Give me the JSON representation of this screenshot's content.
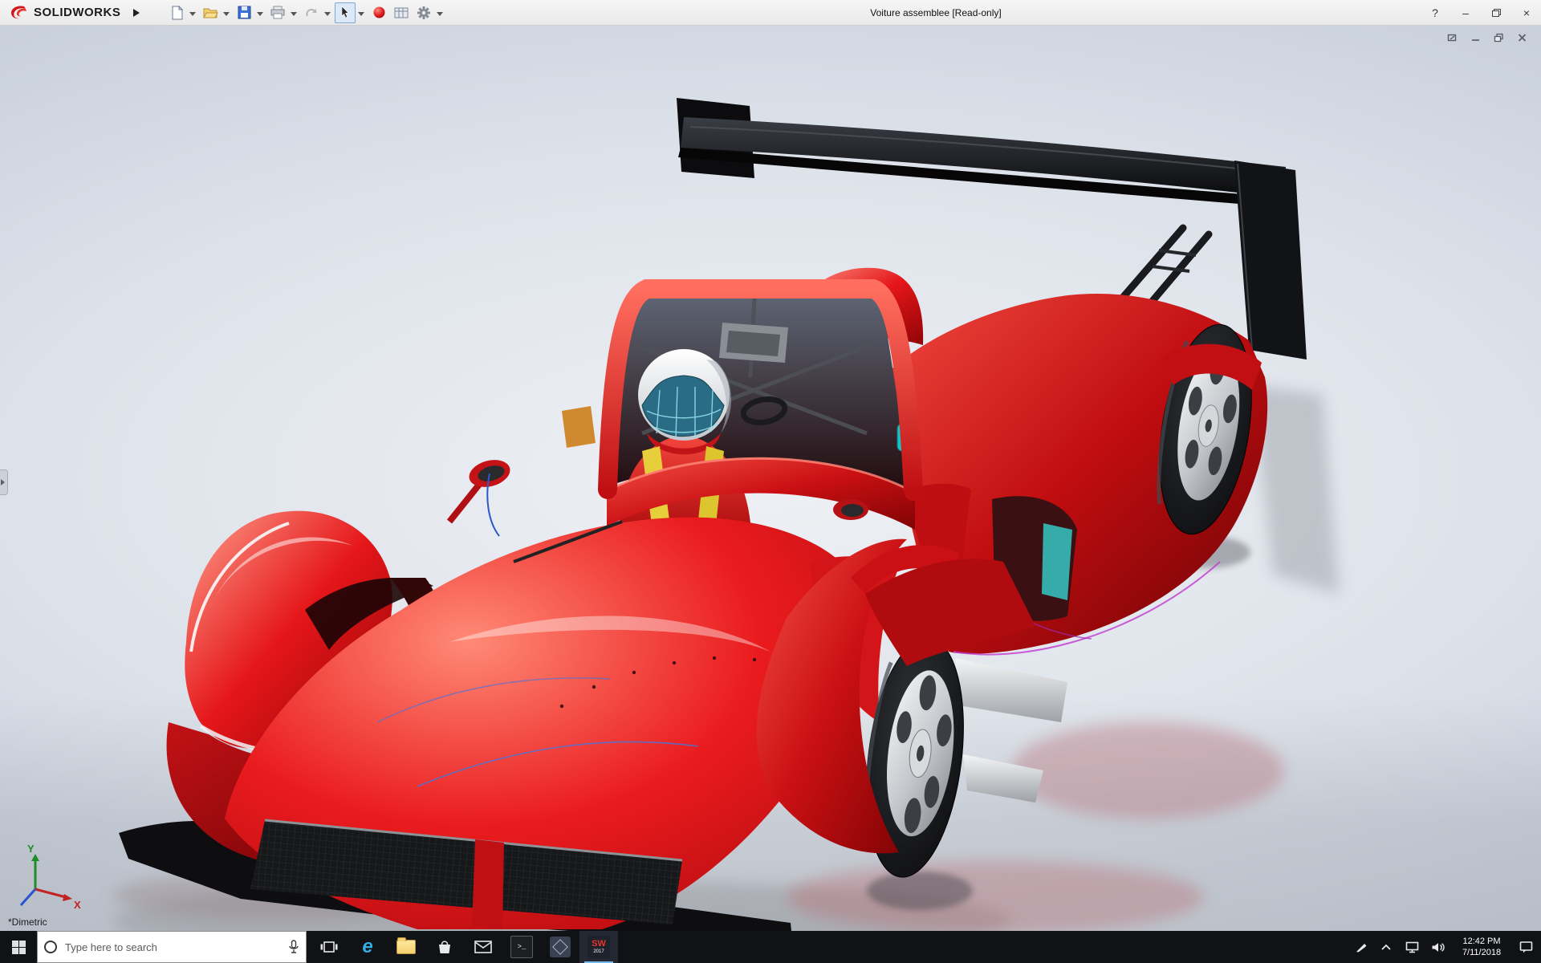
{
  "titlebar": {
    "brand": "SOLIDWORKS",
    "title": "Voiture assemblee [Read-only]",
    "help_label": "?",
    "minimize_label": "–",
    "close_label": "×"
  },
  "toolbar": {
    "items": [
      "new-document",
      "open",
      "save",
      "print",
      "undo",
      "select-cursor",
      "appearance-sphere",
      "display-settings",
      "options-gear"
    ],
    "active_tool": "select-cursor"
  },
  "viewport": {
    "view_label": "*Dimetric",
    "triad": {
      "x_label": "X",
      "y_label": "Y"
    },
    "document_controls": [
      "restore-up",
      "minimize",
      "restore",
      "close"
    ]
  },
  "model": {
    "name": "Voiture assemblee",
    "body_color": "#e8191c",
    "wing_color": "#121214",
    "accent_colors": {
      "teal": "#2bc8c6",
      "yellow": "#e6cf3a",
      "orange": "#cf8a30",
      "magenta": "#c03ad0",
      "helmet": "#ffffff"
    }
  },
  "taskbar": {
    "search_placeholder": "Type here to search",
    "apps": [
      {
        "name": "task-view"
      },
      {
        "name": "edge",
        "glyph": "e"
      },
      {
        "name": "file-explorer"
      },
      {
        "name": "store"
      },
      {
        "name": "mail"
      },
      {
        "name": "command-prompt",
        "glyph": ">_"
      },
      {
        "name": "viewer-app"
      },
      {
        "name": "solidworks-2017",
        "label": "SW",
        "sublabel": "2017",
        "active": true
      }
    ],
    "tray": {
      "time": "12:42 PM",
      "date": "7/11/2018"
    }
  }
}
